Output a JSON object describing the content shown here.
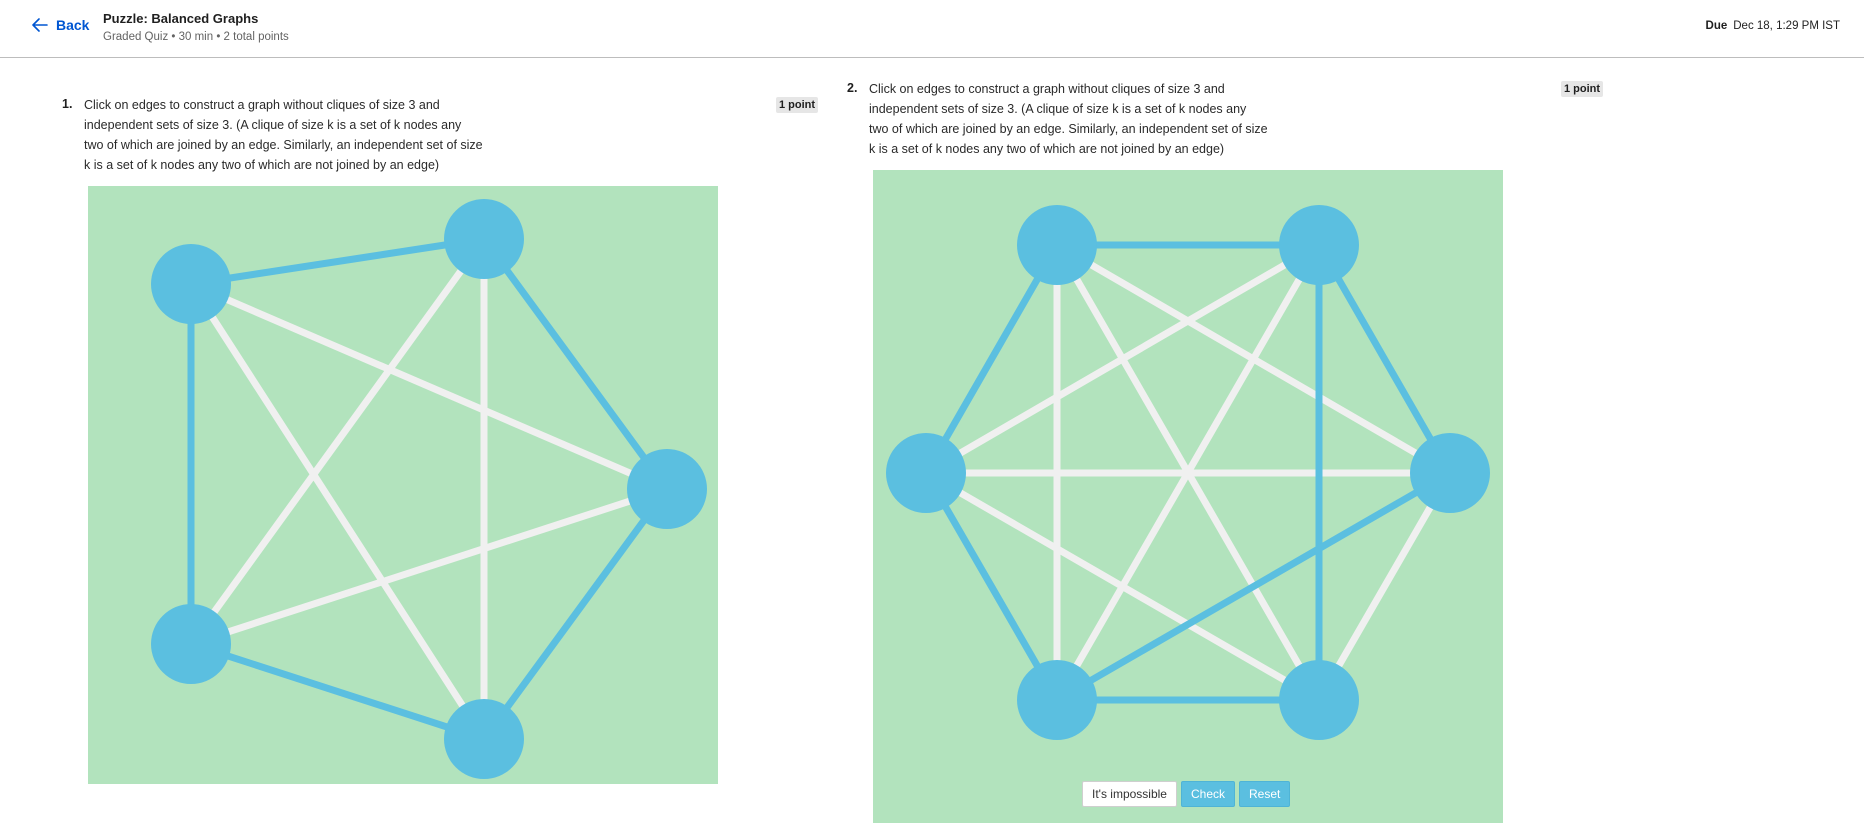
{
  "header": {
    "back_label": "Back",
    "title": "Puzzle: Balanced Graphs",
    "meta": "Graded Quiz • 30 min • 2 total points",
    "due_label": "Due",
    "due_value": "Dec 18, 1:29 PM IST"
  },
  "colors": {
    "node": "#5bbfe0",
    "selected_edge": "#5bbfe0",
    "unselected_edge": "#f0f0f0",
    "canvas_bg": "#b2e3bd"
  },
  "questions": [
    {
      "number": "1.",
      "text": "Click on edges to construct a graph without cliques of size 3 and independent sets of size 3. (A clique of size k is a set of k nodes any two of which are joined by an edge. Similarly, an independent set of size k is a set of k nodes any two of which are not joined by an edge)",
      "points": "1 point",
      "graph": {
        "node_count": 5,
        "nodes": [
          "A",
          "B",
          "C",
          "D",
          "E"
        ],
        "selected_edges": [
          [
            "A",
            "B"
          ],
          [
            "B",
            "C"
          ],
          [
            "C",
            "D"
          ],
          [
            "D",
            "E"
          ],
          [
            "E",
            "A"
          ]
        ],
        "unselected_edges": [
          [
            "A",
            "C"
          ],
          [
            "A",
            "D"
          ],
          [
            "B",
            "D"
          ],
          [
            "B",
            "E"
          ],
          [
            "C",
            "E"
          ]
        ]
      }
    },
    {
      "number": "2.",
      "text": "Click on edges to construct a graph without cliques of size 3 and independent sets of size 3. (A clique of size k is a set of k nodes any two of which are joined by an edge. Similarly, an independent set of size k is a set of k nodes any two of which are not joined by an edge)",
      "points": "1 point",
      "graph": {
        "node_count": 6,
        "nodes": [
          "A",
          "B",
          "C",
          "D",
          "E",
          "F"
        ],
        "selected_edges": [
          [
            "A",
            "B"
          ],
          [
            "A",
            "F"
          ],
          [
            "F",
            "E"
          ],
          [
            "E",
            "D"
          ],
          [
            "B",
            "C"
          ],
          [
            "B",
            "D"
          ],
          [
            "C",
            "E"
          ]
        ],
        "unselected_edges": [
          [
            "A",
            "C"
          ],
          [
            "A",
            "D"
          ],
          [
            "A",
            "E"
          ],
          [
            "B",
            "E"
          ],
          [
            "B",
            "F"
          ],
          [
            "C",
            "D"
          ],
          [
            "C",
            "F"
          ],
          [
            "D",
            "F"
          ]
        ]
      },
      "buttons": {
        "impossible": "It's impossible",
        "check": "Check",
        "reset": "Reset"
      }
    }
  ]
}
